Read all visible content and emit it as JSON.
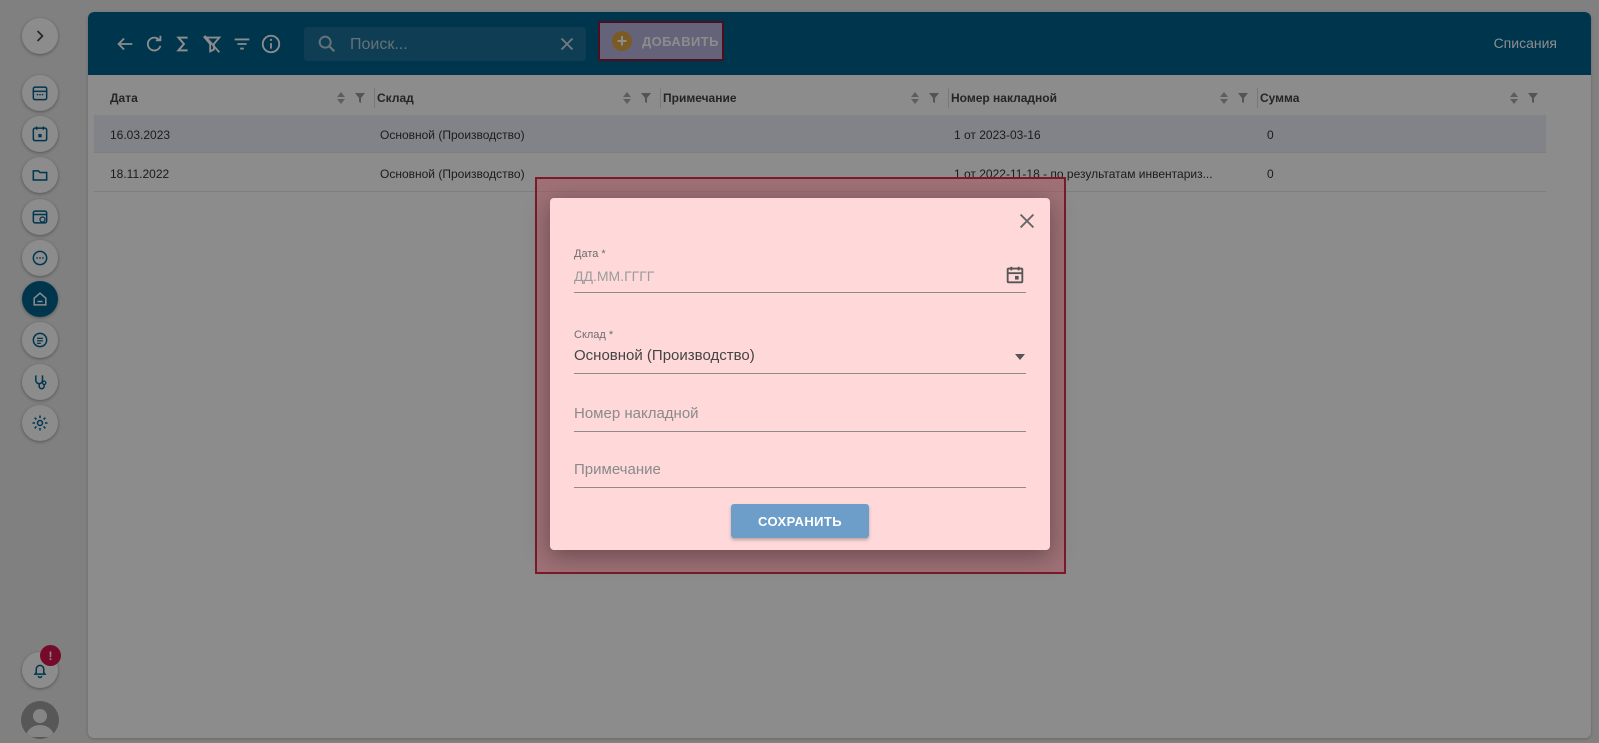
{
  "toolbar": {
    "search_placeholder": "Поиск...",
    "add_label": "ДОБАВИТЬ",
    "title": "Списания"
  },
  "table": {
    "columns": [
      "Дата",
      "Склад",
      "Примечание",
      "Номер накладной",
      "Сумма"
    ],
    "rows": [
      {
        "date": "16.03.2023",
        "warehouse": "Основной (Производство)",
        "note": "",
        "invoice": "1 от 2023-03-16",
        "sum": "0"
      },
      {
        "date": "18.11.2022",
        "warehouse": "Основной (Производство)",
        "note": "",
        "invoice": "1 от 2022-11-18 - по результатам инвентариз...",
        "sum": "0"
      }
    ]
  },
  "notifications": {
    "badge": "!"
  },
  "dialog": {
    "date_label": "Дата *",
    "date_placeholder": "ДД.ММ.ГГГГ",
    "warehouse_label": "Склад *",
    "warehouse_value": "Основной (Производство)",
    "invoice_placeholder": "Номер накладной",
    "note_placeholder": "Примечание",
    "save_label": "СОХРАНИТЬ"
  },
  "colors": {
    "primary": "#00618f",
    "dialog_bg": "#ffd9d9",
    "save_button": "#6c9ec9",
    "badge": "#d6134e"
  }
}
